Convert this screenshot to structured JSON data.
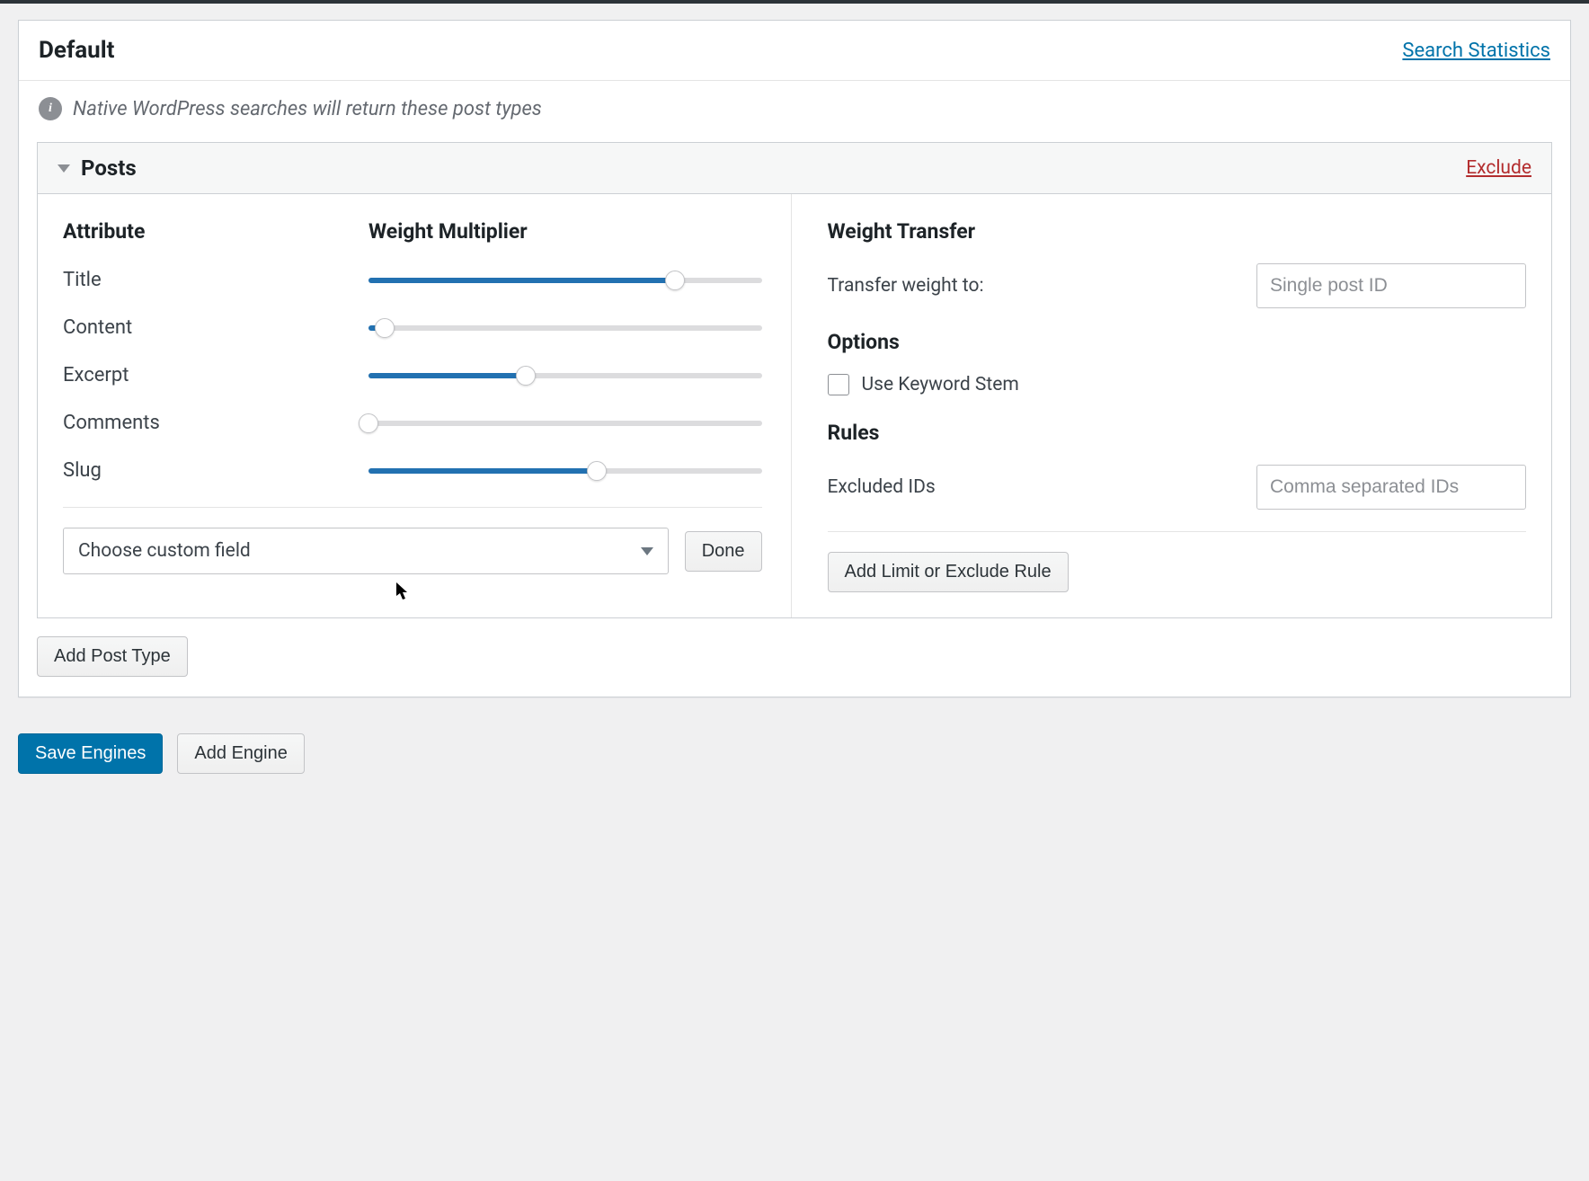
{
  "header": {
    "title": "Default",
    "stats_link": "Search Statistics"
  },
  "info": "Native WordPress searches will return these post types",
  "post_type": {
    "name": "Posts",
    "exclude": "Exclude",
    "headers": {
      "attr": "Attribute",
      "weight": "Weight Multiplier"
    },
    "attributes": [
      {
        "label": "Title",
        "pct": 78
      },
      {
        "label": "Content",
        "pct": 4
      },
      {
        "label": "Excerpt",
        "pct": 40
      },
      {
        "label": "Comments",
        "pct": 0
      },
      {
        "label": "Slug",
        "pct": 58
      }
    ],
    "custom_field": {
      "placeholder": "Choose custom field",
      "done": "Done"
    }
  },
  "right": {
    "weight_transfer": {
      "heading": "Weight Transfer",
      "label": "Transfer weight to:",
      "placeholder": "Single post ID"
    },
    "options": {
      "heading": "Options",
      "keyword_stem": "Use Keyword Stem"
    },
    "rules": {
      "heading": "Rules",
      "excluded_label": "Excluded IDs",
      "excluded_placeholder": "Comma separated IDs",
      "add_rule": "Add Limit or Exclude Rule"
    }
  },
  "buttons": {
    "add_post_type": "Add Post Type",
    "save_engines": "Save Engines",
    "add_engine": "Add Engine"
  }
}
